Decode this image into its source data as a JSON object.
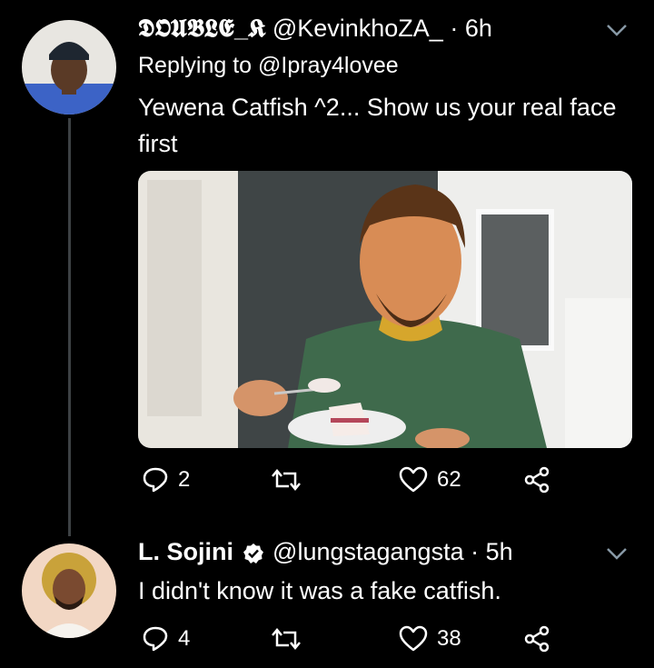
{
  "tweet1": {
    "display_name": "𝕯𝕺𝖀𝕭𝕷𝕰_𝕶",
    "handle": "@KevinkhoZA_",
    "separator": "·",
    "time": "6h",
    "replying_prefix": "Replying to",
    "replying_to": "@Ipray4lovee",
    "text": "Yewena Catfish ^2... Show us your real face first",
    "reply_count": "2",
    "like_count": "62"
  },
  "tweet2": {
    "display_name": "L. Sojini",
    "handle": "@lungstagangsta",
    "separator": "·",
    "time": "5h",
    "text": "I didn't know it was a fake catfish.",
    "reply_count": "4",
    "like_count": "38"
  },
  "icons": {
    "reply": "reply-icon",
    "retweet": "retweet-icon",
    "like": "like-icon",
    "share": "share-icon",
    "chevron": "chevron-down-icon",
    "verified": "verified-badge-icon"
  },
  "colors": {
    "background": "#000000",
    "text": "#ffffff",
    "thread_line": "#3d4144",
    "icon": "#8899a6"
  }
}
